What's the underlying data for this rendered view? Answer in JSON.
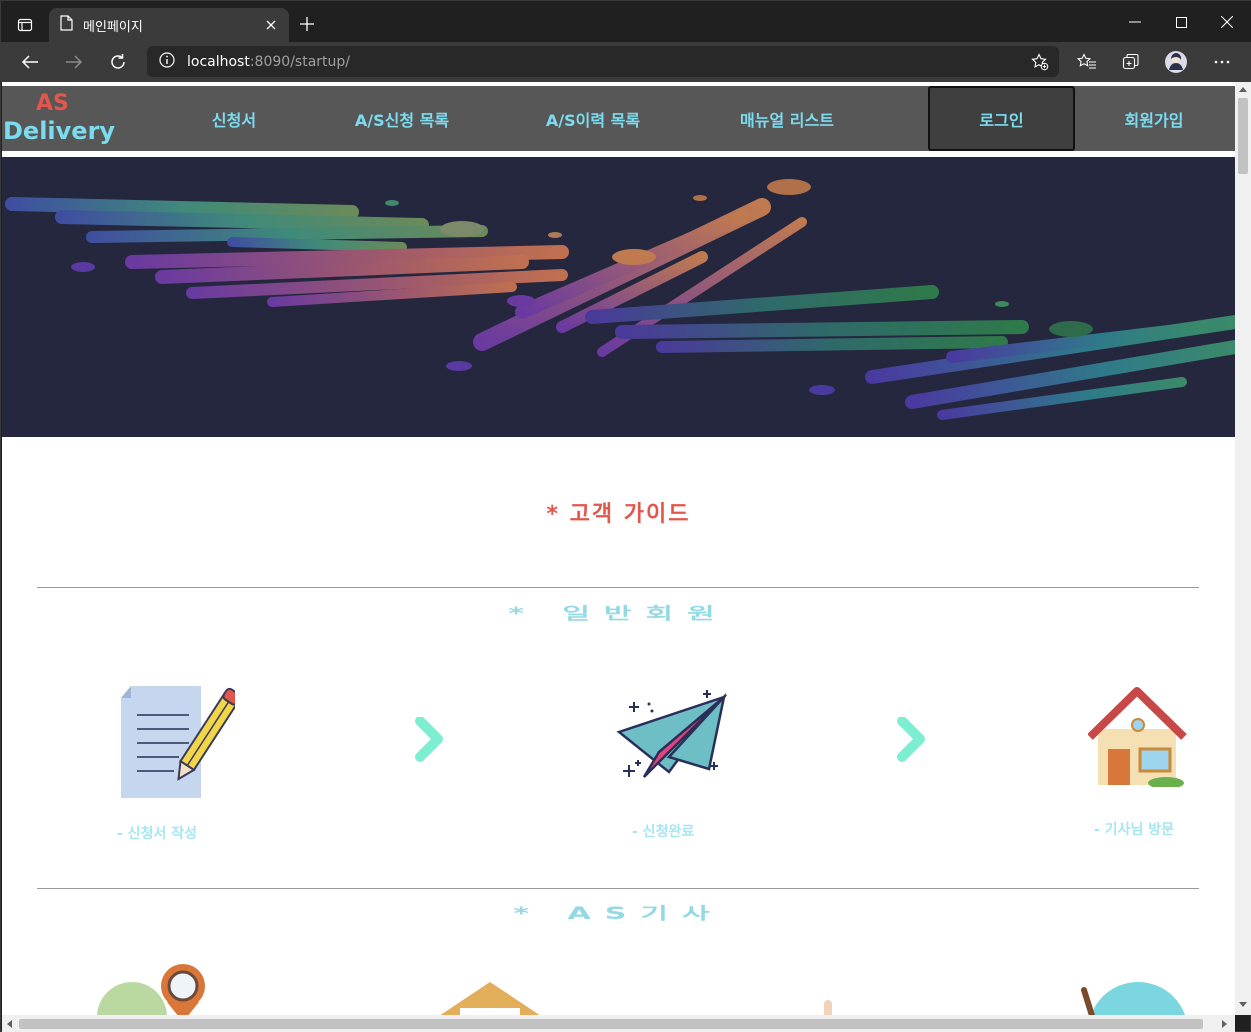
{
  "browser": {
    "tab_title": "메인페이지",
    "url_host": "localhost",
    "url_path": ":8090/startup/"
  },
  "site": {
    "logo_line1": "AS",
    "logo_line2": "Delivery",
    "nav": [
      "신청서",
      "A/S신청 목록",
      "A/S이력 목록",
      "매뉴얼 리스트",
      "로그인",
      "회원가입"
    ]
  },
  "content": {
    "guide_title": "* 고객 가이드",
    "section1_title": "* 일반회원",
    "steps": [
      "- 신청서 작성",
      "- 신청완료",
      "- 기사님 방문"
    ],
    "section2_title": "* AS기사"
  },
  "colors": {
    "nav_bg": "#575757",
    "nav_text": "#7bdcf0",
    "accent_red": "#e2574c",
    "banner_bg": "#25273f"
  }
}
